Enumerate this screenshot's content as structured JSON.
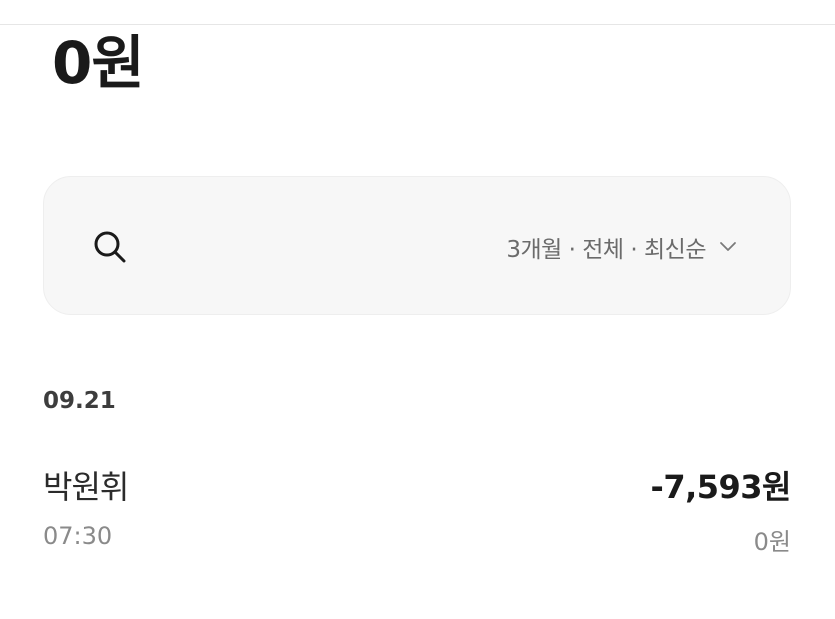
{
  "account": {
    "balance": "0원"
  },
  "search": {
    "filter_label": "3개월 · 전체 · 최신순",
    "icon": "search-icon",
    "dropdown_icon": "chevron-down-icon"
  },
  "transactions": [
    {
      "date": "09.21",
      "items": [
        {
          "name": "박원휘",
          "time": "07:30",
          "amount": "-7,593원",
          "balance_after": "0원"
        }
      ]
    }
  ],
  "colors": {
    "search_bg": "#f7f7f7",
    "primary_text": "#1a1a1a",
    "secondary_text": "#8a8a8a"
  }
}
